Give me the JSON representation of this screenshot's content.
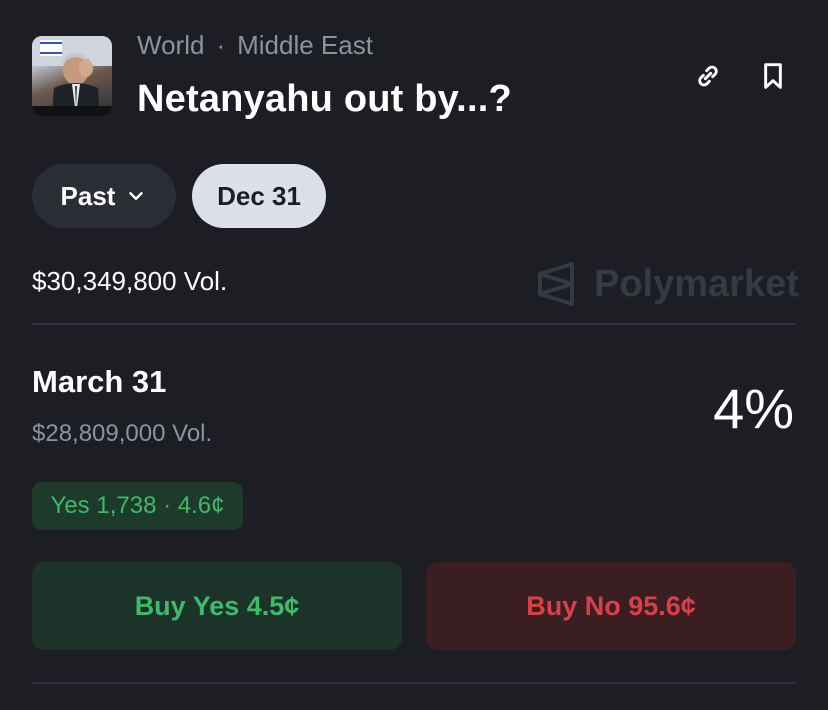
{
  "header": {
    "breadcrumb": [
      "World",
      "Middle East"
    ],
    "separator": "·",
    "title": "Netanyahu out by...?",
    "thumbnail_icon": "news-photo"
  },
  "actions": {
    "link_icon": "link-icon",
    "bookmark_icon": "bookmark-icon"
  },
  "filters": {
    "past_label": "Past",
    "selected_date": "Dec 31"
  },
  "market": {
    "total_volume": "$30,349,800 Vol.",
    "brand": "Polymarket"
  },
  "outcome": {
    "title": "March 31",
    "volume": "$28,809,000 Vol.",
    "probability": "4%",
    "yes_badge": "Yes 1,738 · 4.6¢",
    "buy_yes": "Buy Yes 4.5¢",
    "buy_no": "Buy No 95.6¢"
  },
  "colors": {
    "background": "#1c1e23",
    "yes_green": "#3fb96a",
    "no_red": "#d94148",
    "muted_text": "#8a93a3"
  }
}
